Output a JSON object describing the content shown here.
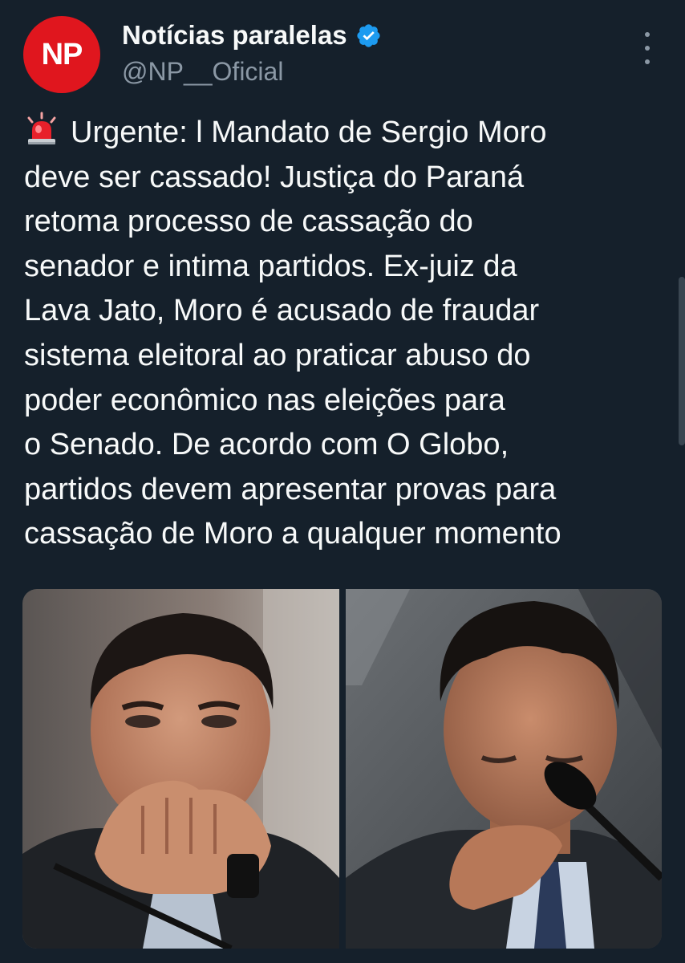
{
  "account": {
    "display_name": "Notícias paralelas",
    "handle": "@NP__Oficial",
    "avatar_text": "NP",
    "verified": true
  },
  "tweet": {
    "lines": [
      "Urgente: l  Mandato de Sergio Moro",
      "deve ser cassado! Justiça do Paraná",
      "retoma processo de cassação do",
      "senador e intima partidos. Ex-juiz da",
      "Lava Jato, Moro é acusado de fraudar",
      "sistema eleitoral ao praticar abuso do",
      "poder econômico nas eleições para",
      "o Senado. De acordo com O Globo,",
      "partidos devem apresentar provas para",
      "cassação de Moro a qualquer momento"
    ],
    "leading_icon": "rotating-light-icon"
  },
  "media": {
    "count": 2,
    "items": [
      "photo",
      "photo"
    ]
  },
  "colors": {
    "background": "#15202b",
    "text": "#f7f9f9",
    "secondary_text": "#8b98a5",
    "verified_blue": "#1d9bf0",
    "avatar_red": "#e0161e"
  }
}
